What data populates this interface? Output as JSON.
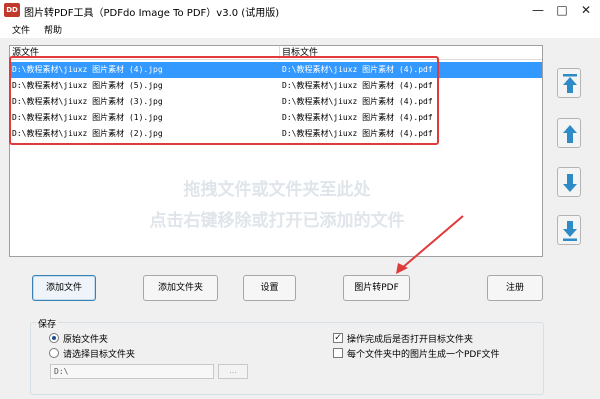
{
  "window": {
    "icon_text": "DD",
    "title": "图片转PDF工具（PDFdo Image To PDF）v3.0 (试用版)",
    "minimize": "—",
    "maximize": "□",
    "close": "✕"
  },
  "menu": {
    "file": "文件",
    "help": "帮助"
  },
  "list": {
    "col_source": "源文件",
    "col_target": "目标文件",
    "rows": [
      {
        "source": "D:\\教程素材\\jiuxz 图片素材 (4).jpg",
        "target": "D:\\教程素材\\jiuxz 图片素材 (4).pdf",
        "selected": true
      },
      {
        "source": "D:\\教程素材\\jiuxz 图片素材 (5).jpg",
        "target": "D:\\教程素材\\jiuxz 图片素材 (4).pdf",
        "selected": false
      },
      {
        "source": "D:\\教程素材\\jiuxz 图片素材 (3).jpg",
        "target": "D:\\教程素材\\jiuxz 图片素材 (4).pdf",
        "selected": false
      },
      {
        "source": "D:\\教程素材\\jiuxz 图片素材 (1).jpg",
        "target": "D:\\教程素材\\jiuxz 图片素材 (4).pdf",
        "selected": false
      },
      {
        "source": "D:\\教程素材\\jiuxz 图片素材 (2).jpg",
        "target": "D:\\教程素材\\jiuxz 图片素材 (4).pdf",
        "selected": false
      }
    ],
    "hint_line1": "拖拽文件或文件夹至此处",
    "hint_line2": "点击右键移除或打开已添加的文件"
  },
  "side_buttons": [
    "move-top-icon",
    "move-up-icon",
    "move-down-icon",
    "move-bottom-icon"
  ],
  "buttons": {
    "add_file": "添加文件",
    "add_folder": "添加文件夹",
    "settings": "设置",
    "convert": "图片转PDF",
    "register": "注册"
  },
  "save": {
    "group_label": "保存",
    "option_original": "原始文件夹",
    "option_choose": "请选择目标文件夹",
    "path_value": "D:\\",
    "browse_label": "...",
    "open_after": "操作完成后是否打开目标文件夹",
    "one_pdf_per_folder": "每个文件夹中的图片生成一个PDF文件"
  },
  "colors": {
    "selection": "#3399ff",
    "highlight_box": "#e03a3a",
    "arrow_button": "#2e8bc6"
  }
}
